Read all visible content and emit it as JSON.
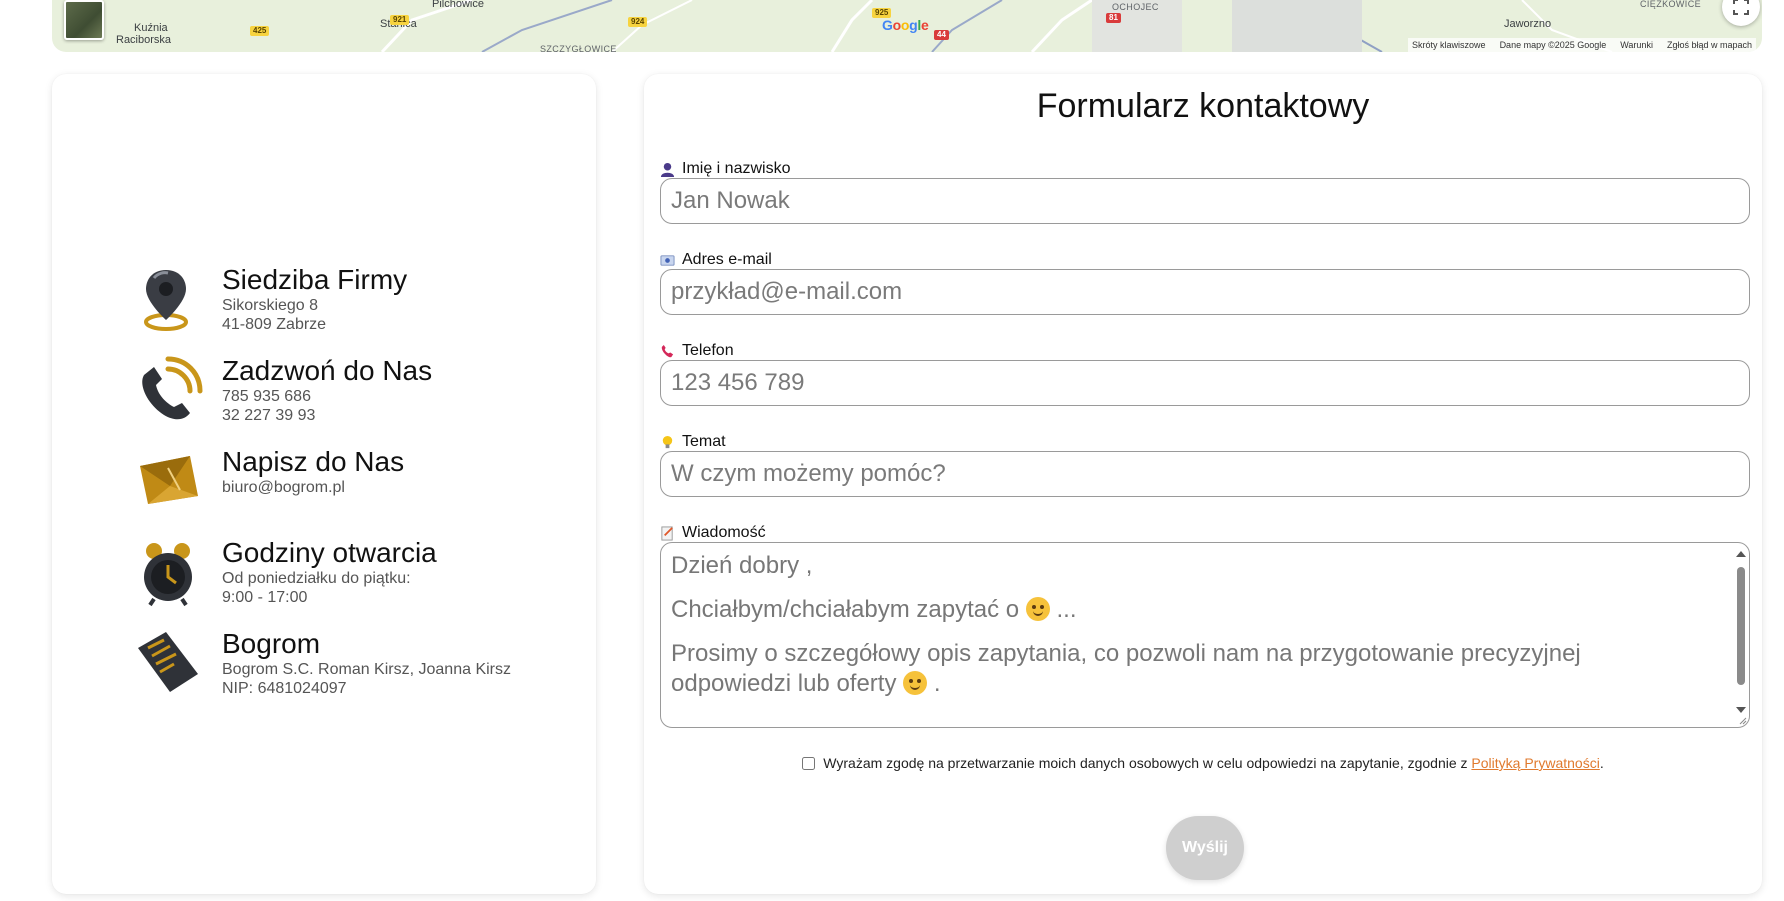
{
  "map": {
    "places": [
      "Kuźnia",
      "Raciborska",
      "Stanica",
      "Pilchowice",
      "SZCZYGŁOWICE",
      "OCHOJEC",
      "Jaworzno",
      "CIĘŻKOWICE"
    ],
    "roads": [
      "425",
      "921",
      "924",
      "925",
      "81",
      "44"
    ],
    "google_logo": "Google",
    "attribution": [
      "Skróty klawiszowe",
      "Dane mapy ©2025 Google",
      "Warunki",
      "Zgłoś błąd w mapach"
    ]
  },
  "contact_info": [
    {
      "title": "Siedziba Firmy",
      "lines": [
        "Sikorskiego 8",
        "41-809 Zabrze"
      ],
      "icon": "location-pin-icon"
    },
    {
      "title": "Zadzwoń do Nas",
      "lines": [
        "785 935 686",
        "32 227 39 93"
      ],
      "icon": "phone-icon"
    },
    {
      "title": "Napisz do Nas",
      "lines": [
        "biuro@bogrom.pl"
      ],
      "icon": "envelope-icon"
    },
    {
      "title": "Godziny otwarcia",
      "lines": [
        "Od poniedziałku do piątku:",
        "9:00 - 17:00"
      ],
      "icon": "alarm-clock-icon"
    },
    {
      "title": "Bogrom",
      "lines": [
        "Bogrom S.C. Roman Kirsz, Joanna Kirsz",
        "NIP: 6481024097"
      ],
      "icon": "document-icon"
    }
  ],
  "form": {
    "title": "Formularz kontaktowy",
    "name": {
      "label": "Imię i nazwisko",
      "placeholder": "Jan Nowak"
    },
    "email": {
      "label": "Adres e-mail",
      "placeholder": "przykład@e-mail.com"
    },
    "phone": {
      "label": "Telefon",
      "placeholder": "123 456 789"
    },
    "subject": {
      "label": "Temat",
      "placeholder": "W czym możemy pomóc?"
    },
    "message": {
      "label": "Wiadomość",
      "line1": "Dzień dobry ,",
      "line2": "Chciałbym/chciałabym zapytać o",
      "line2_suffix": "...",
      "line3": "Prosimy o szczegółowy opis zapytania, co pozwoli nam na przygotowanie precyzyjnej",
      "line4": "odpowiedzi lub oferty",
      "line4_suffix": "."
    },
    "consent_text": "Wyrażam zgodę na przetwarzanie moich danych osobowych w celu odpowiedzi na zapytanie, zgodnie z",
    "consent_link": "Polityką Prywatności",
    "consent_end": ".",
    "consent_checked": false,
    "submit_label": "Wyślij"
  },
  "colors": {
    "link": "#e07a2e",
    "submit_disabled": "#cfcfcf",
    "map_bg": "#e8f0dc"
  }
}
